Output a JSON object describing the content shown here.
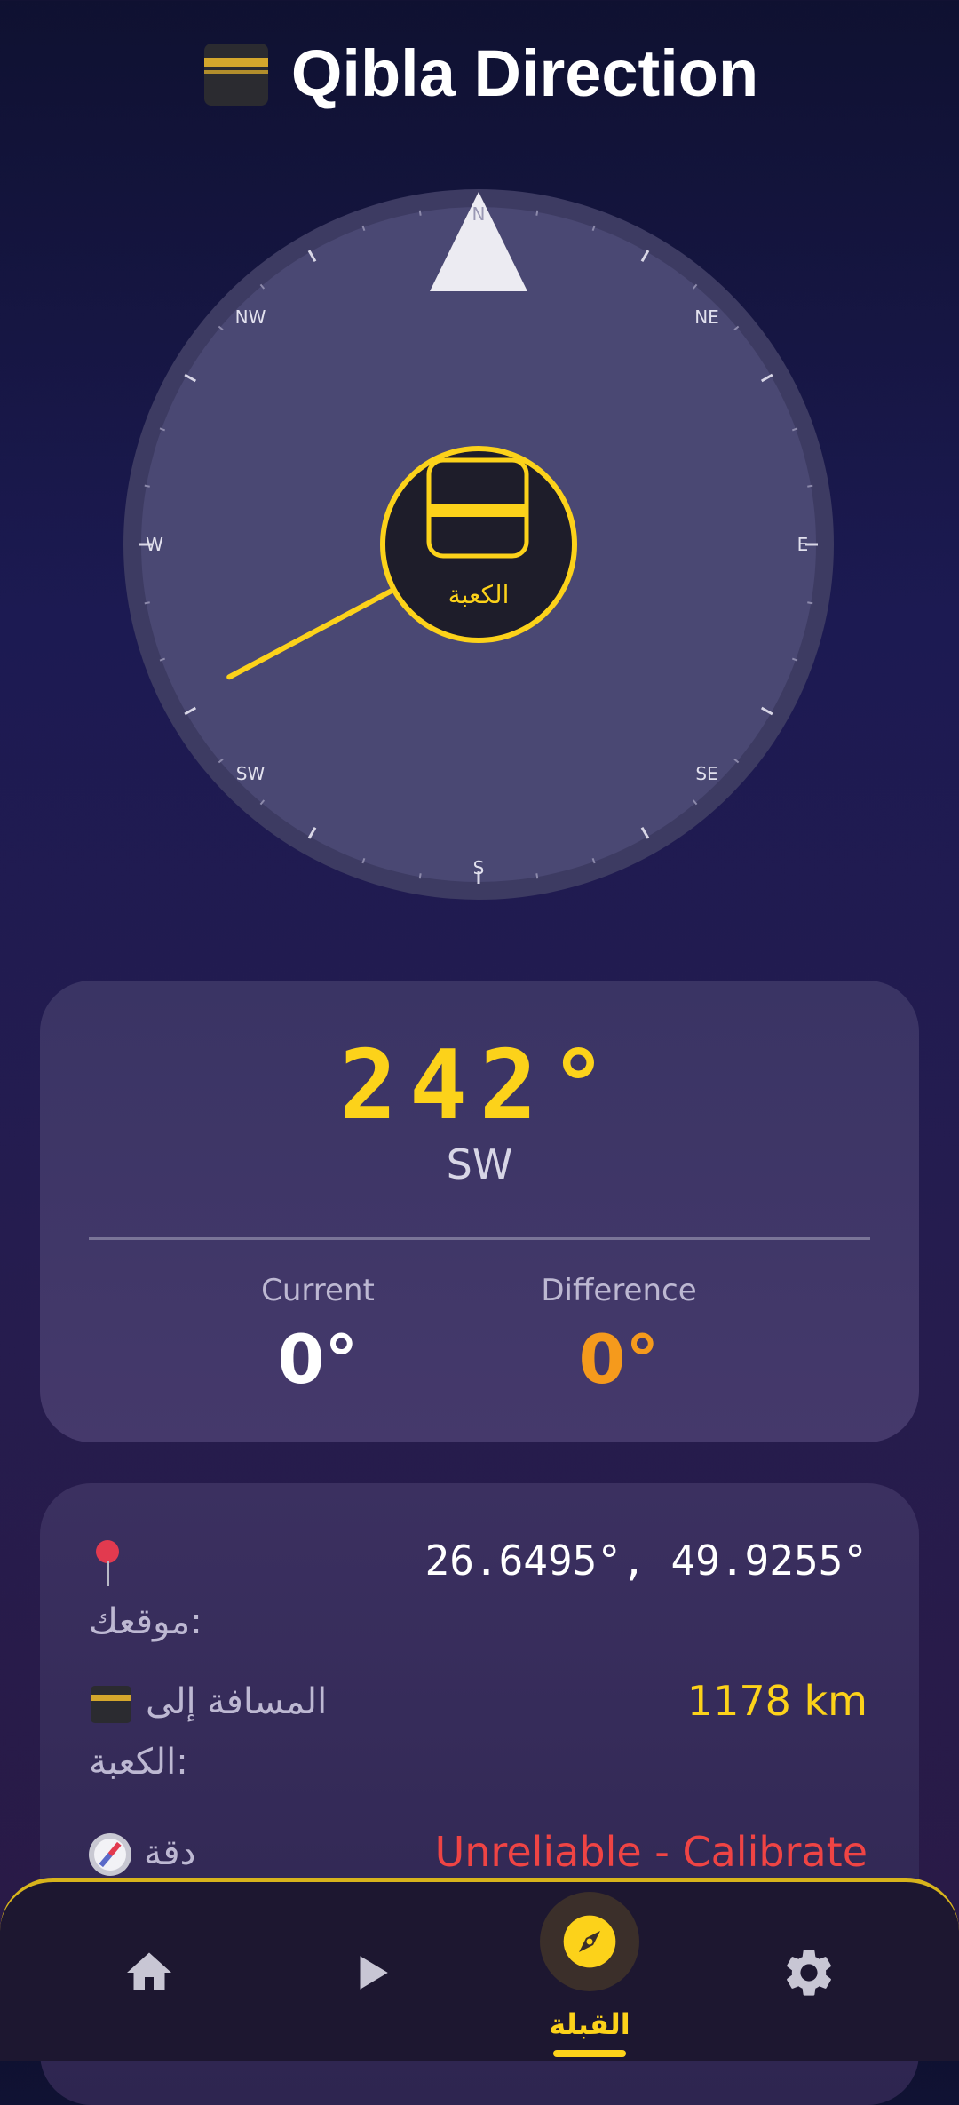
{
  "header": {
    "title": "Qibla Direction",
    "icon": "kaaba-icon"
  },
  "compass": {
    "labels": {
      "n": "N",
      "ne": "NE",
      "e": "E",
      "se": "SE",
      "s": "S",
      "sw": "SW",
      "w": "W",
      "nw": "NW"
    },
    "kaaba_label": "الكعبة",
    "qibla_bearing_deg": 242
  },
  "direction_card": {
    "qibla_degrees": "242°",
    "qibla_direction": "SW",
    "current_label": "Current",
    "current_value": "0°",
    "difference_label": "Difference",
    "difference_value": "0°"
  },
  "info_card": {
    "location_icon": "pin-icon",
    "location_label": "موقعك:",
    "location_value": "26.6495°, 49.9255°",
    "distance_icon": "kaaba-icon",
    "distance_label_line1": "المسافة إلى",
    "distance_label_line2": "الكعبة:",
    "distance_value": "1178 km",
    "accuracy_icon": "compass-icon",
    "accuracy_label": "دقة",
    "accuracy_value": "Unreliable - Calibrate"
  },
  "nav": {
    "items": [
      {
        "name": "home",
        "icon": "home-icon"
      },
      {
        "name": "play",
        "icon": "play-icon"
      },
      {
        "name": "qibla",
        "icon": "compass-icon",
        "label": "القبلة",
        "active": true
      },
      {
        "name": "settings",
        "icon": "gear-icon"
      }
    ],
    "active_label": "القبلة"
  },
  "colors": {
    "accent": "#fcd21a",
    "difference": "#f59a1c",
    "warning": "#ef4444"
  }
}
